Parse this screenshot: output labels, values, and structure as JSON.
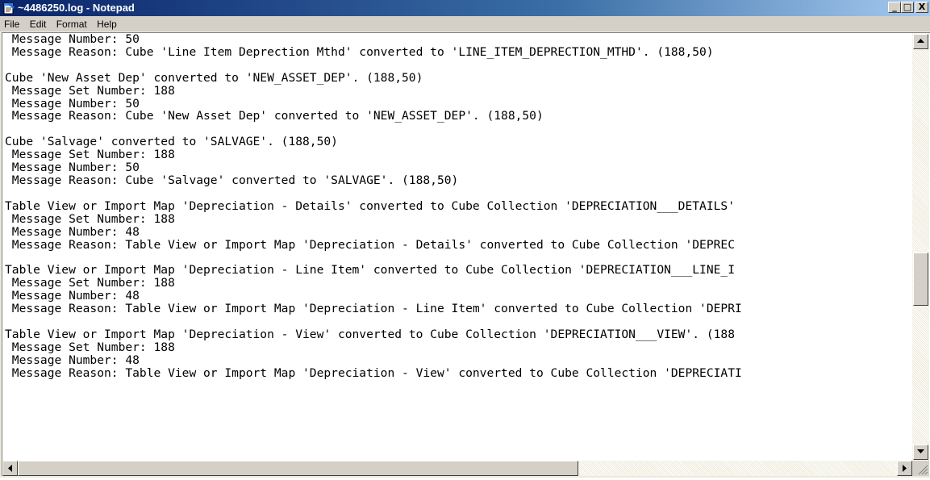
{
  "window": {
    "title": "~4486250.log - Notepad",
    "icon": "notepad-icon"
  },
  "caption_buttons": {
    "minimize": "_",
    "maximize": "□",
    "close": "X"
  },
  "menu": {
    "items": [
      "File",
      "Edit",
      "Format",
      "Help"
    ]
  },
  "editor": {
    "lines": [
      " Message Number: 50",
      " Message Reason: Cube 'Line Item Deprection Mthd' converted to 'LINE_ITEM_DEPRECTION_MTHD'. (188,50)",
      "",
      "Cube 'New Asset Dep' converted to 'NEW_ASSET_DEP'. (188,50)",
      " Message Set Number: 188",
      " Message Number: 50",
      " Message Reason: Cube 'New Asset Dep' converted to 'NEW_ASSET_DEP'. (188,50)",
      "",
      "Cube 'Salvage' converted to 'SALVAGE'. (188,50)",
      " Message Set Number: 188",
      " Message Number: 50",
      " Message Reason: Cube 'Salvage' converted to 'SALVAGE'. (188,50)",
      "",
      "Table View or Import Map 'Depreciation - Details' converted to Cube Collection 'DEPRECIATION___DETAILS'",
      " Message Set Number: 188",
      " Message Number: 48",
      " Message Reason: Table View or Import Map 'Depreciation - Details' converted to Cube Collection 'DEPREC",
      "",
      "Table View or Import Map 'Depreciation - Line Item' converted to Cube Collection 'DEPRECIATION___LINE_I",
      " Message Set Number: 188",
      " Message Number: 48",
      " Message Reason: Table View or Import Map 'Depreciation - Line Item' converted to Cube Collection 'DEPRI",
      "",
      "Table View or Import Map 'Depreciation - View' converted to Cube Collection 'DEPRECIATION___VIEW'. (188",
      " Message Set Number: 188",
      " Message Number: 48",
      " Message Reason: Table View or Import Map 'Depreciation - View' converted to Cube Collection 'DEPRECIATI"
    ]
  }
}
